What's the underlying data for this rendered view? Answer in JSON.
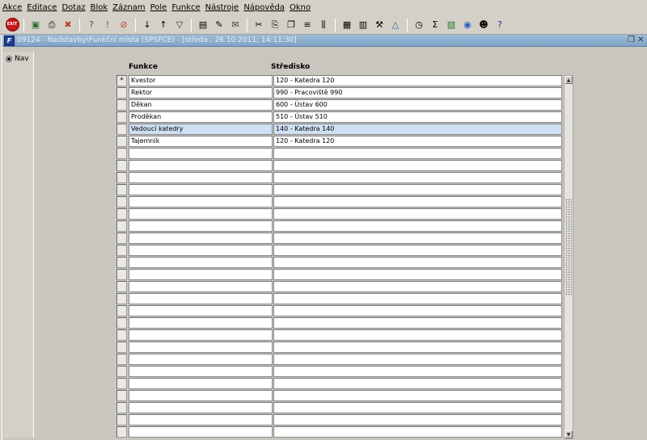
{
  "menu": [
    "Akce",
    "Editace",
    "Dotaz",
    "Blok",
    "Záznam",
    "Pole",
    "Funkce",
    "Nástroje",
    "Nápověda",
    "Okno"
  ],
  "toolbar": {
    "exit_label": "EXIT",
    "groups": [
      [
        "exit-icon"
      ],
      [
        "save-icon",
        "print-icon",
        "delete-icon"
      ],
      [
        "enter-query-icon",
        "execute-query-icon",
        "cancel-query-icon"
      ],
      [
        "sort-asc-icon",
        "sort-desc-icon",
        "filter-icon"
      ],
      [
        "print-preview-icon",
        "edit-doc-icon",
        "mail-icon"
      ],
      [
        "cut-icon",
        "copy-icon",
        "paste-icon",
        "indent-icon",
        "columns-icon"
      ],
      [
        "calendar-icon",
        "calculator-icon",
        "tools-icon",
        "triangle-icon"
      ],
      [
        "clock-icon",
        "sum-icon",
        "excel-icon",
        "web-icon",
        "user-icon",
        "help-icon"
      ]
    ]
  },
  "window": {
    "title": "09124 - Nadstavby\\Funkční místa (SPSFCE) - [středa , 26.10.2011; 14:11:30]",
    "icon_label": "F"
  },
  "nav": {
    "label": "Nav",
    "selected": true
  },
  "table": {
    "columns": [
      "Funkce",
      "Středisko"
    ],
    "current_row_marker": "*",
    "rows": [
      {
        "funkce": "Kvestor",
        "stredisko": "120 - Katedra 120"
      },
      {
        "funkce": "Rektor",
        "stredisko": "990 - Pracoviště 990"
      },
      {
        "funkce": "Děkan",
        "stredisko": "600 - Ústav 600"
      },
      {
        "funkce": "Proděkan",
        "stredisko": "510 - Ústav 510"
      },
      {
        "funkce": "Vedoucí katedry",
        "stredisko": "140 - Katedra 140"
      },
      {
        "funkce": "Tajemník",
        "stredisko": "120 - Katedra 120"
      }
    ],
    "selected_row": 4,
    "empty_rows": 24
  }
}
